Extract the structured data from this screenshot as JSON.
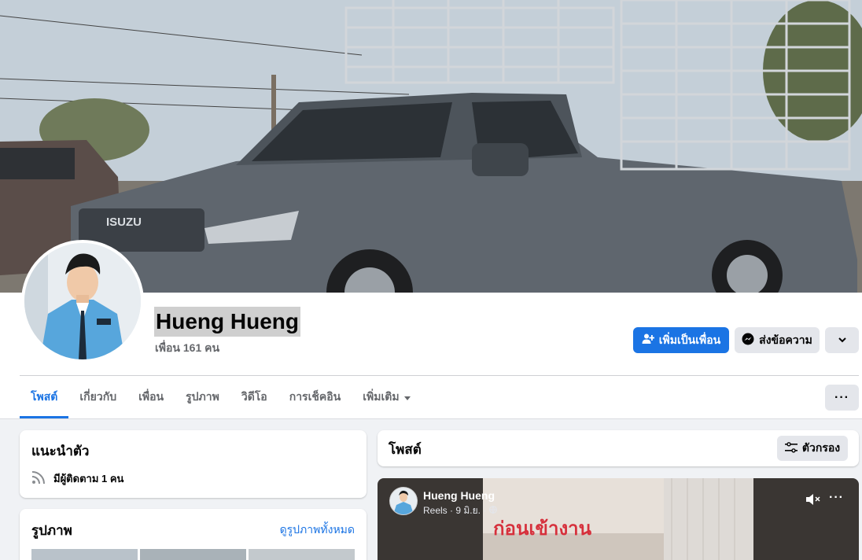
{
  "profile": {
    "name": "Hueng Hueng",
    "friends_text": "เพื่อน 161 คน"
  },
  "actions": {
    "add_friend": "เพิ่มเป็นเพื่อน",
    "message": "ส่งข้อความ"
  },
  "tabs": [
    {
      "label": "โพสต์",
      "active": true
    },
    {
      "label": "เกี่ยวกับ",
      "active": false
    },
    {
      "label": "เพื่อน",
      "active": false
    },
    {
      "label": "รูปภาพ",
      "active": false
    },
    {
      "label": "วิดีโอ",
      "active": false
    },
    {
      "label": "การเช็คอิน",
      "active": false
    },
    {
      "label": "เพิ่มเติม",
      "active": false
    }
  ],
  "intro": {
    "title": "แนะนำตัว",
    "followers": "มีผู้ติดตาม 1 คน"
  },
  "photos": {
    "title": "รูปภาพ",
    "see_all": "ดูรูปภาพทั้งหมด"
  },
  "posts": {
    "title": "โพสต์",
    "filter_label": "ตัวกรอง"
  },
  "reel_post": {
    "author": "Hueng Hueng",
    "meta": "Reels · 9 มิ.ย. ·",
    "overlay_text": "ก่อนเข้างาน"
  },
  "cover": {
    "vehicle_badge": "ISUZU"
  },
  "colors": {
    "accent": "#1b74e4",
    "page_bg": "#f0f2f5"
  }
}
